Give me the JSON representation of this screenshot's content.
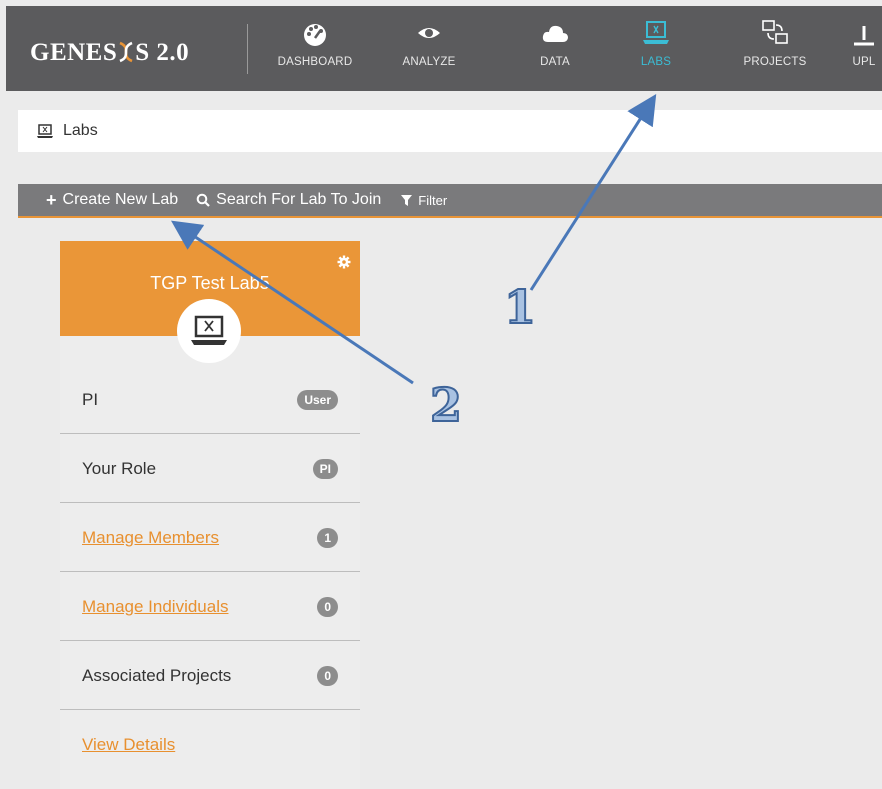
{
  "app": {
    "logo_text_before": "GENES",
    "logo_text_after": "S 2.0"
  },
  "nav": {
    "items": [
      {
        "label": "DASHBOARD",
        "icon": "speedometer-icon"
      },
      {
        "label": "ANALYZE",
        "icon": "eye-icon"
      },
      {
        "label": "DATA",
        "icon": "cloud-icon"
      },
      {
        "label": "LABS",
        "icon": "laptop-dna-icon",
        "active": true
      },
      {
        "label": "PROJECTS",
        "icon": "projects-icon"
      },
      {
        "label": "UPL",
        "icon": "upload-icon"
      }
    ]
  },
  "breadcrumb": {
    "label": "Labs"
  },
  "toolbar": {
    "create_label": "Create New Lab",
    "search_label": "Search For Lab To Join",
    "filter_label": "Filter"
  },
  "lab_card": {
    "title": "TGP Test Lab5",
    "rows": [
      {
        "label": "PI",
        "badge": "User",
        "is_link": false
      },
      {
        "label": "Your Role",
        "badge": "PI",
        "is_link": false
      },
      {
        "label": "Manage Members",
        "badge": "1",
        "is_link": true
      },
      {
        "label": "Manage Individuals",
        "badge": "0",
        "is_link": true
      },
      {
        "label": "Associated Projects",
        "badge": "0",
        "is_link": false
      },
      {
        "label": "View Details",
        "badge": null,
        "is_link": true
      }
    ]
  },
  "annotations": {
    "marker_1": "1",
    "marker_2": "2"
  },
  "colors": {
    "nav_bg": "#5b5b5d",
    "active": "#3bbdd5",
    "accent_orange": "#ea9638",
    "arrow": "#4a78b8"
  }
}
